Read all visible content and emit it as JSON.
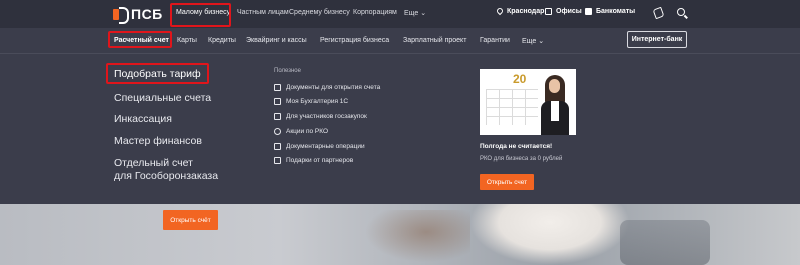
{
  "brand": {
    "name": "ПСБ"
  },
  "segments": [
    {
      "label": "Малому бизнесу"
    },
    {
      "label": "Частным лицам"
    },
    {
      "label": "Среднему бизнесу"
    },
    {
      "label": "Корпорациям"
    },
    {
      "label": "Еще"
    }
  ],
  "top_right": {
    "city": "Краснодар",
    "offices": "Офисы",
    "atms": "Банкоматы"
  },
  "nav": {
    "items": [
      {
        "label": "Расчетный счет"
      },
      {
        "label": "Карты"
      },
      {
        "label": "Кредиты"
      },
      {
        "label": "Эквайринг и кассы"
      },
      {
        "label": "Регистрация бизнеса"
      },
      {
        "label": "Зарплатный проект"
      },
      {
        "label": "Гарантии"
      },
      {
        "label": "Еще"
      }
    ],
    "internet_bank": "Интернет-банк"
  },
  "menu": {
    "left": [
      {
        "label": "Подобрать тариф"
      },
      {
        "label": "Специальные счета"
      },
      {
        "label": "Инкассация"
      },
      {
        "label": "Мастер финансов"
      },
      {
        "label": "Отдельный счет"
      },
      {
        "label": "для Гособоронзаказа"
      }
    ],
    "useful_title": "Полезное",
    "links": [
      {
        "label": "Документы для открытия счета"
      },
      {
        "label": "Моя Бухгалтерия 1С"
      },
      {
        "label": "Для участников госзакупок"
      },
      {
        "label": "Акции по РКО"
      },
      {
        "label": "Документарные операции"
      },
      {
        "label": "Подарки от партнеров"
      }
    ],
    "promo": {
      "calendar_number": "20",
      "title": "Полгода не считается!",
      "subtitle": "РКО для бизнеса за 0 рублей",
      "button": "Открыть счет"
    }
  },
  "hero": {
    "button": "Открыть счёт"
  },
  "colors": {
    "accent": "#f26522",
    "highlight": "#e0151b",
    "bg": "#3b3d4b"
  }
}
